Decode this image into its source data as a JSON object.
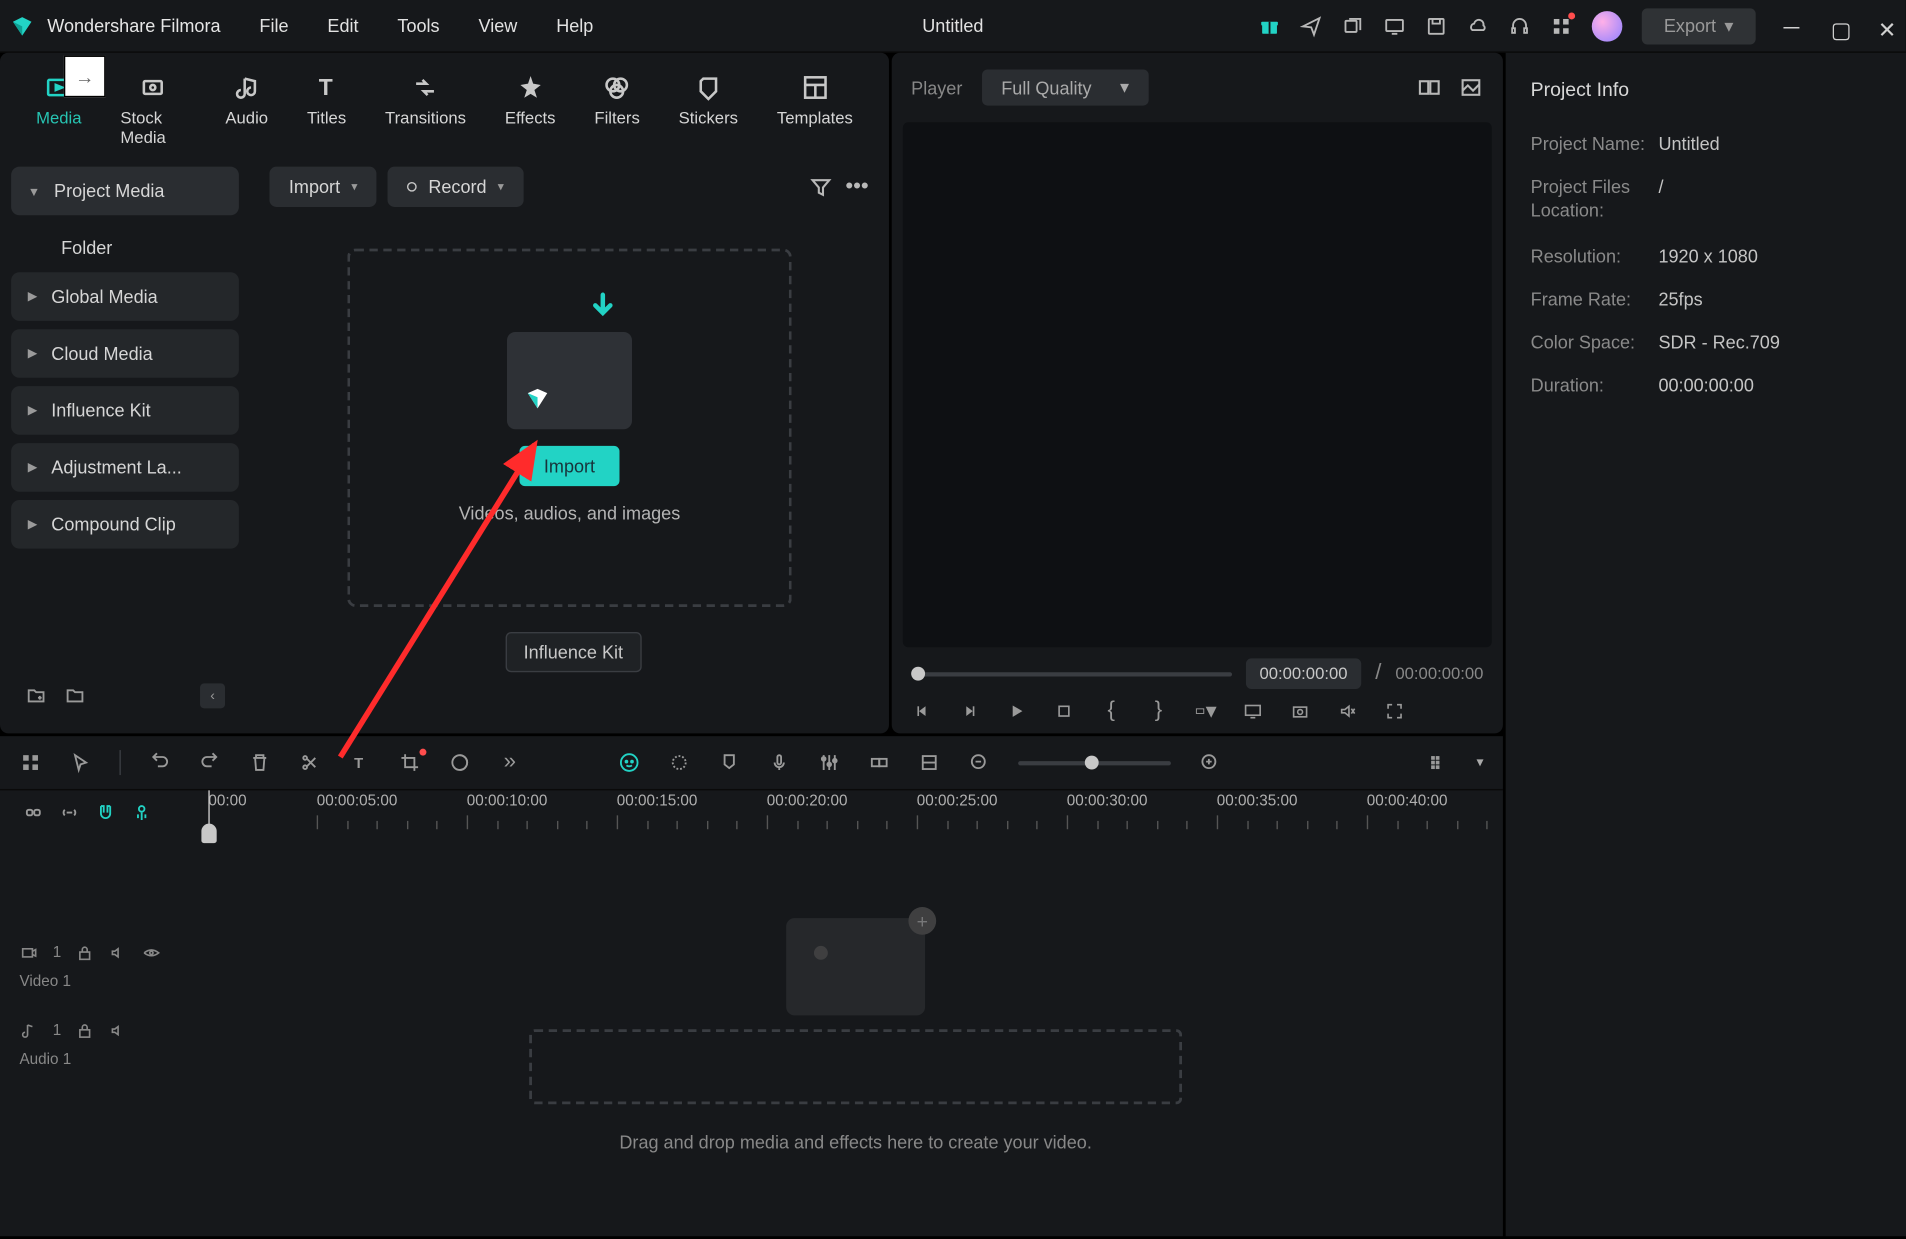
{
  "titlebar": {
    "app_name": "Wondershare Filmora",
    "menus": [
      "File",
      "Edit",
      "Tools",
      "View",
      "Help"
    ],
    "document_title": "Untitled",
    "export_label": "Export"
  },
  "tabs": [
    {
      "label": "Media",
      "active": true
    },
    {
      "label": "Stock Media",
      "active": false
    },
    {
      "label": "Audio",
      "active": false
    },
    {
      "label": "Titles",
      "active": false
    },
    {
      "label": "Transitions",
      "active": false
    },
    {
      "label": "Effects",
      "active": false
    },
    {
      "label": "Filters",
      "active": false
    },
    {
      "label": "Stickers",
      "active": false
    },
    {
      "label": "Templates",
      "active": false
    }
  ],
  "sidebar": {
    "items": [
      {
        "label": "Project Media",
        "expanded": true
      },
      {
        "label": "Folder",
        "sub": true
      },
      {
        "label": "Global Media",
        "expanded": false
      },
      {
        "label": "Cloud Media",
        "expanded": false
      },
      {
        "label": "Influence Kit",
        "expanded": false
      },
      {
        "label": "Adjustment La...",
        "expanded": false
      },
      {
        "label": "Compound Clip",
        "expanded": false
      }
    ]
  },
  "media_toolbar": {
    "import_label": "Import",
    "record_label": "Record"
  },
  "drop_zone": {
    "button": "Import",
    "help": "Videos, audios, and images"
  },
  "tooltip": "Influence Kit",
  "player": {
    "label": "Player",
    "quality": "Full Quality",
    "current_time": "00:00:00:00",
    "separator": "/",
    "duration": "00:00:00:00"
  },
  "info": {
    "title": "Project Info",
    "rows": [
      {
        "label": "Project Name:",
        "value": "Untitled"
      },
      {
        "label": "Project Files Location:",
        "value": "/"
      },
      {
        "label": "Resolution:",
        "value": "1920 x 1080"
      },
      {
        "label": "Frame Rate:",
        "value": "25fps"
      },
      {
        "label": "Color Space:",
        "value": "SDR - Rec.709"
      },
      {
        "label": "Duration:",
        "value": "00:00:00:00"
      }
    ]
  },
  "timeline": {
    "ruler": [
      "00:00:05:00",
      "00:00:10:00",
      "00:00:15:00",
      "00:00:20:00",
      "00:00:25:00",
      "00:00:30:00",
      "00:00:35:00",
      "00:00:40:00"
    ],
    "playhead_time": "00:00",
    "tracks": {
      "video": {
        "name": "Video 1",
        "index": "1"
      },
      "audio": {
        "name": "Audio 1",
        "index": "1"
      }
    },
    "drop_text": "Drag and drop media and effects here to create your video."
  }
}
